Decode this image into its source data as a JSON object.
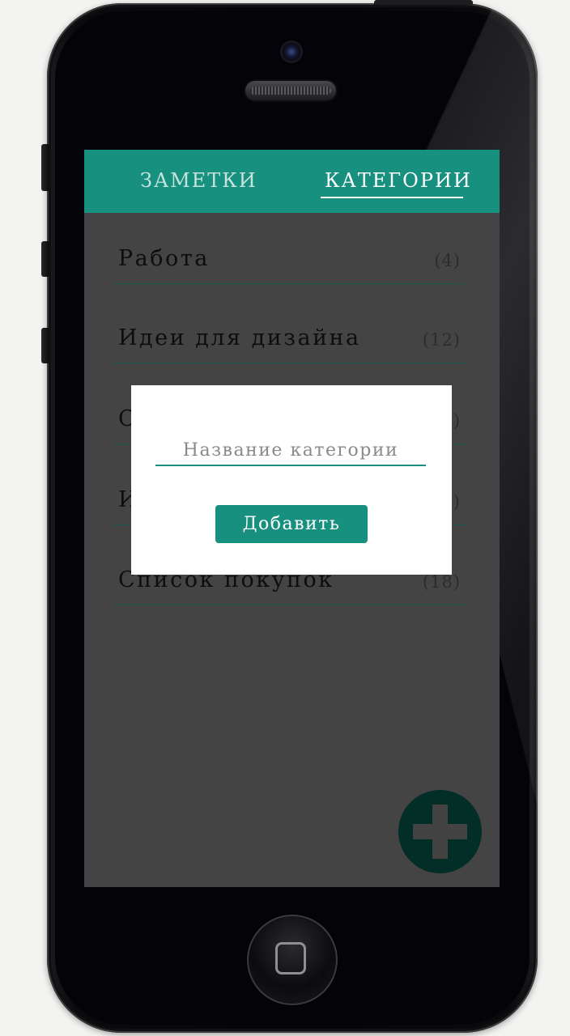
{
  "tabs": [
    {
      "label": "ЗАМЕТКИ",
      "active": false
    },
    {
      "label": "КАТЕГОРИИ",
      "active": true
    }
  ],
  "categories": [
    {
      "label": "Работа",
      "count": "(4)"
    },
    {
      "label": "Идеи для дизайна",
      "count": "(12)"
    },
    {
      "label": "С",
      "count": ")"
    },
    {
      "label": "И",
      "count": ")"
    },
    {
      "label": "Список покупок",
      "count": "(18)"
    }
  ],
  "dialog": {
    "placeholder": "Название категории",
    "add_label": "Добавить"
  },
  "fab": {
    "icon": "plus-icon"
  },
  "colors": {
    "accent": "#18907f",
    "screen_bg": "#444444",
    "fab_bg": "#032d27",
    "page_bg": "#f3f4f1"
  }
}
